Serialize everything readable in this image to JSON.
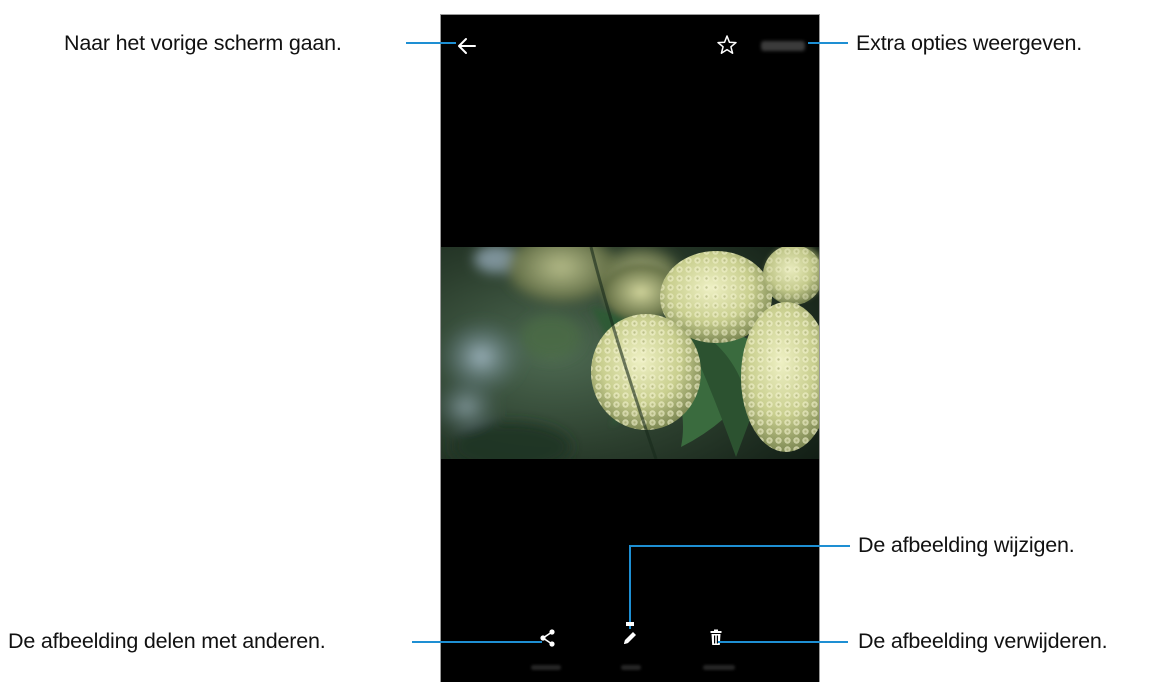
{
  "callouts": {
    "back": "Naar het vorige scherm gaan.",
    "more": "Extra opties weergeven.",
    "edit": "De afbeelding wijzigen.",
    "share": "De afbeelding delen met anderen.",
    "delete": "De afbeelding verwijderen."
  },
  "icons": {
    "back": "arrow-left-icon",
    "favorite": "star-outline-icon",
    "share": "share-icon",
    "edit": "pencil-icon",
    "delete": "trash-icon"
  },
  "colors": {
    "leader_line": "#1e8fd3",
    "screen_background": "#000000"
  }
}
